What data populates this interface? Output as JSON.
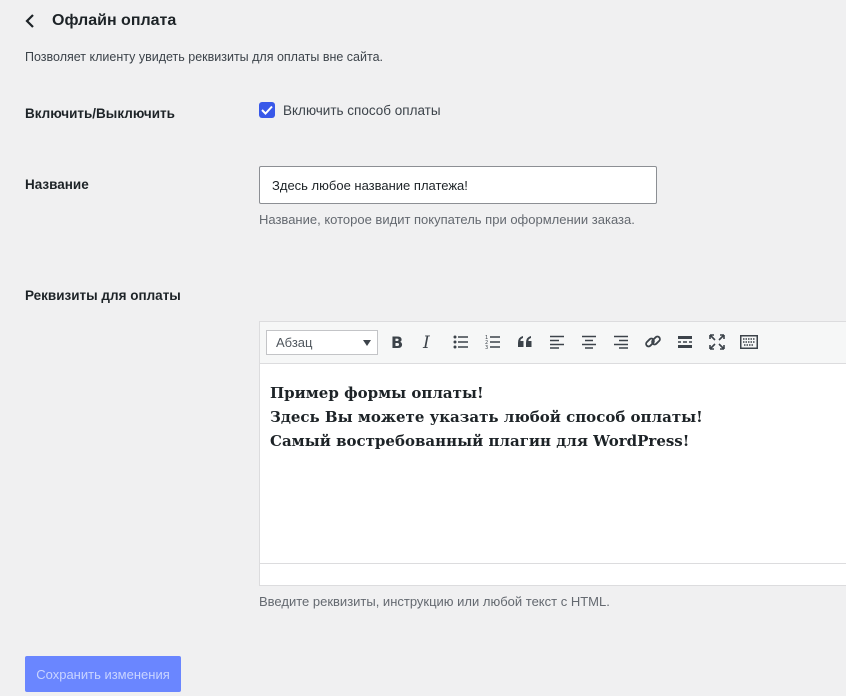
{
  "header": {
    "title": "Офлайн оплата"
  },
  "description": "Позволяет клиенту увидеть реквизиты для оплаты вне сайта.",
  "enable": {
    "label": "Включить/Выключить",
    "checkbox_label": "Включить способ оплаты",
    "checked": true
  },
  "name": {
    "label": "Название",
    "value": "Здесь любое название платежа!",
    "hint": "Название, которое видит покупатель при оформлении заказа."
  },
  "details": {
    "label": "Реквизиты для оплаты",
    "format_select": "Абзац",
    "toolbar": [
      "bold-icon",
      "italic-icon",
      "bullet-list-icon",
      "numbered-list-icon",
      "blockquote-icon",
      "align-left-icon",
      "align-center-icon",
      "align-right-icon",
      "link-icon",
      "read-more-icon",
      "fullscreen-icon",
      "toolbar-toggle-icon"
    ],
    "content_lines": [
      "Пример формы оплаты!",
      "Здесь Вы можете указать любой способ оплаты!",
      "Самый востребованный плагин для WordPress!"
    ],
    "hint": "Введите реквизиты, инструкцию или любой текст с HTML."
  },
  "save_button": "Сохранить изменения",
  "colors": {
    "accent": "#3858e9",
    "button_disabled": "#6a86ff",
    "background": "#f0f0f1"
  }
}
